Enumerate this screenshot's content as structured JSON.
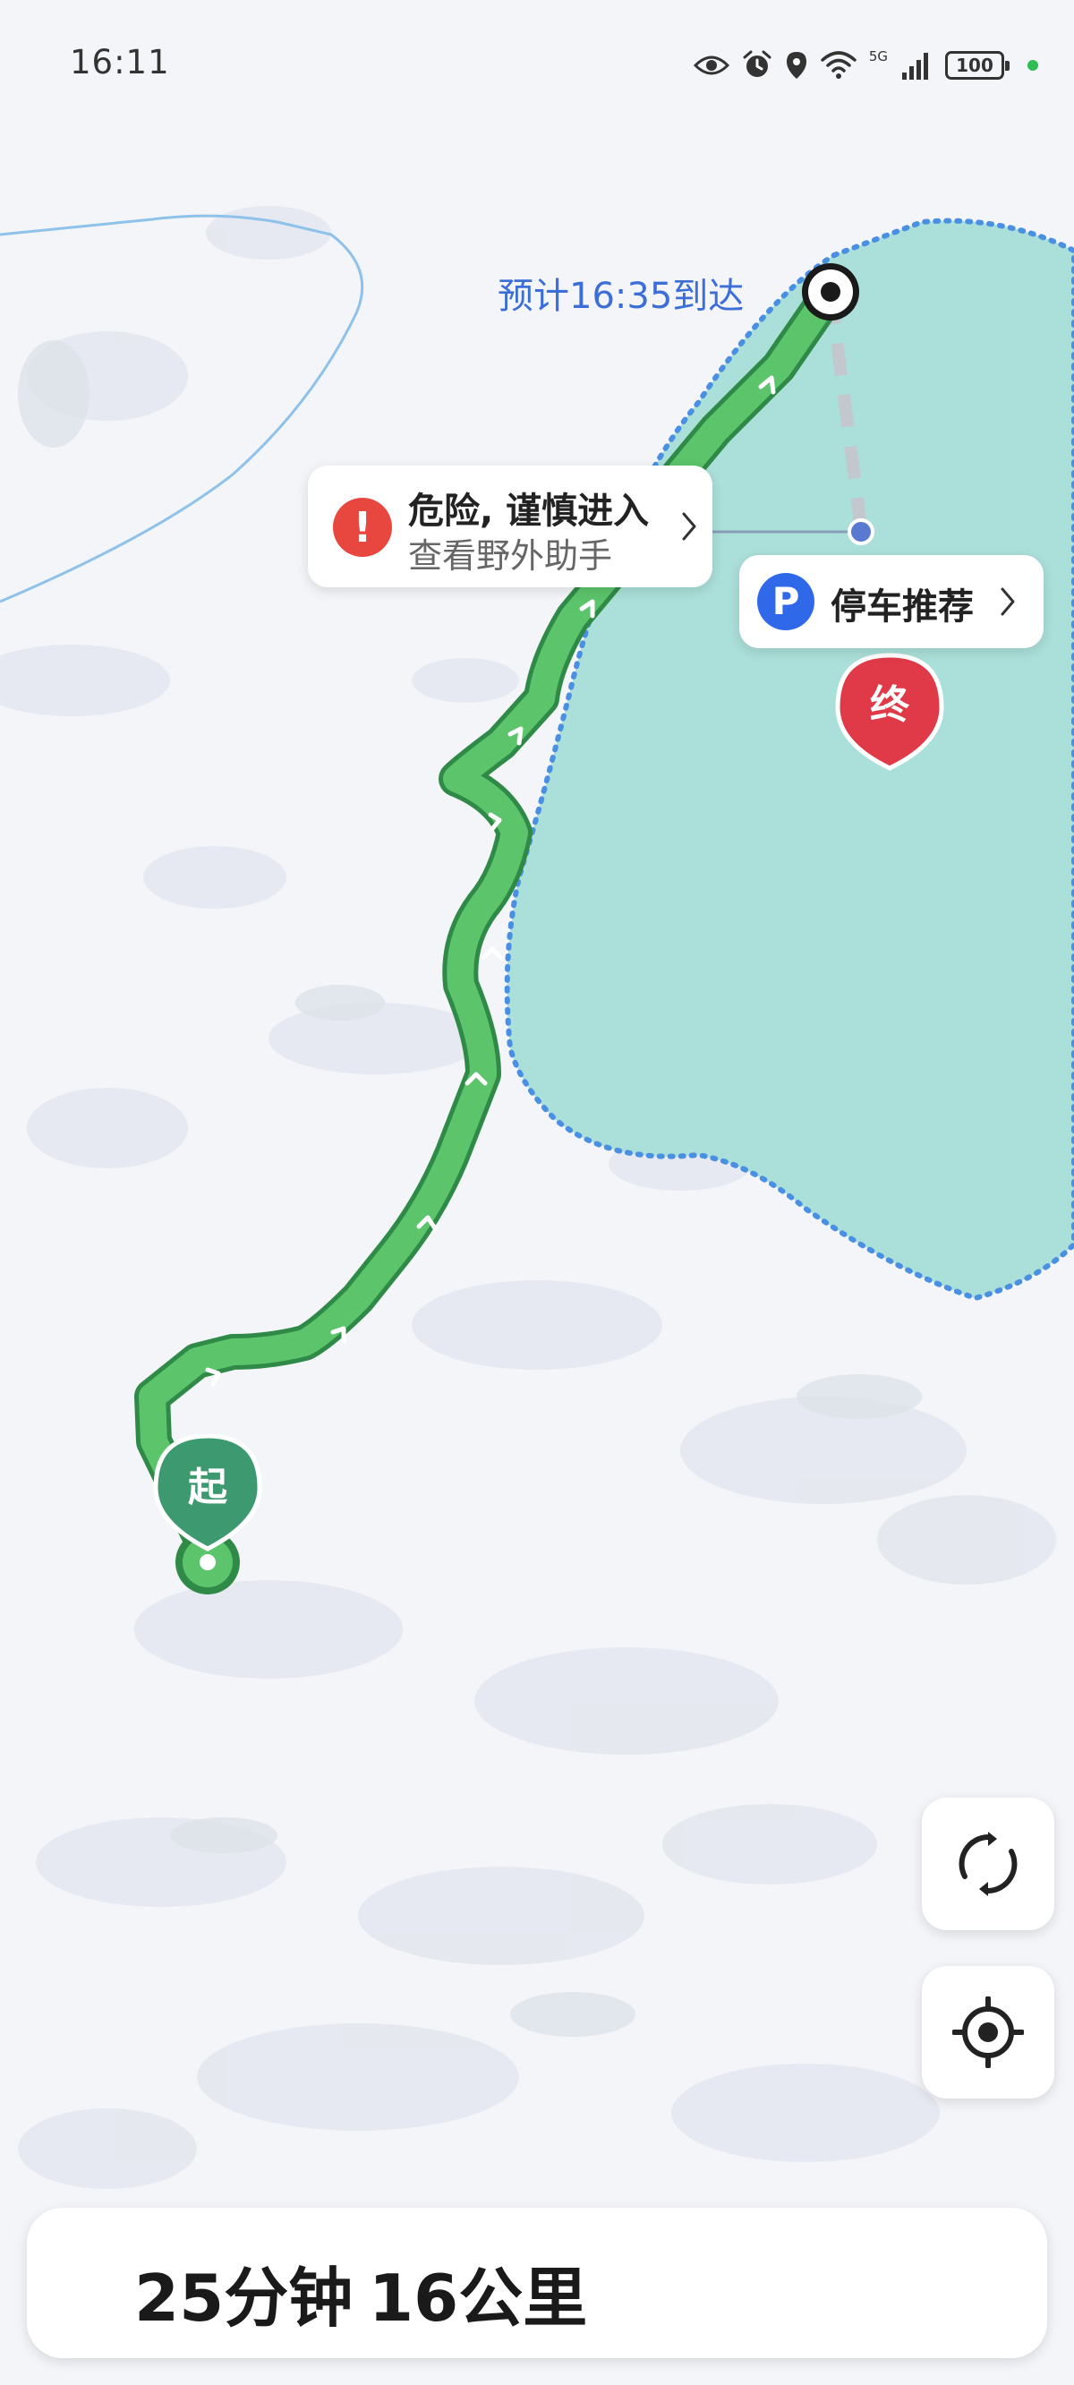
{
  "status_bar": {
    "time": "16:11",
    "network_label": "5G",
    "battery": "100",
    "icons": [
      "eye-icon",
      "alarm-icon",
      "location-pin-icon",
      "wifi-icon",
      "signal-icon",
      "battery-icon"
    ]
  },
  "map": {
    "eta_label": "预计16:35到达",
    "start_marker": "起",
    "end_marker": "终",
    "route_color": "#5cc46b",
    "lake_color": "#abdfd9",
    "lake_border_color": "#4a90e2",
    "region_border_color": "#8ec2ea"
  },
  "danger_card": {
    "title": "危险, 谨慎进入",
    "subtitle": "查看野外助手",
    "icon": "exclamation-icon",
    "color": "#e8473f"
  },
  "parking_card": {
    "label": "停车推荐",
    "icon_letter": "P",
    "color": "#2f69e9"
  },
  "controls": {
    "refresh_icon": "refresh-icon",
    "locate_icon": "crosshair-icon"
  },
  "summary": {
    "duration": "25分钟",
    "distance": "16公里"
  }
}
